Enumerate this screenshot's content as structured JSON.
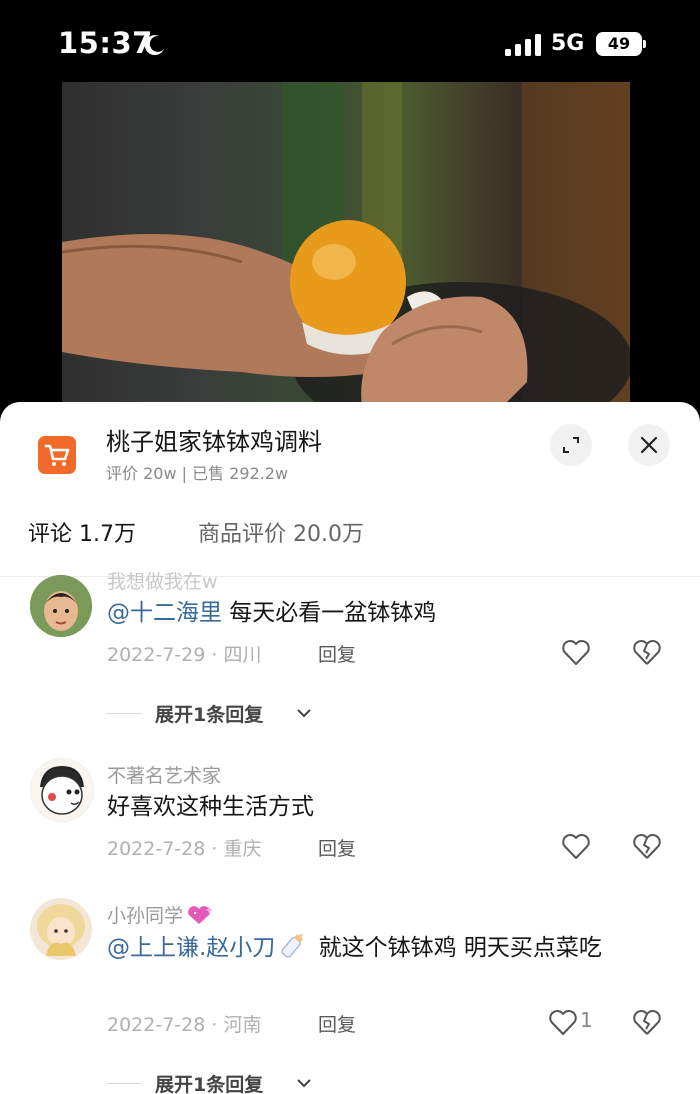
{
  "status_bar": {
    "time": "15:37",
    "network": "5G",
    "battery": "49"
  },
  "product": {
    "title": "桃子姐家钵钵鸡调料",
    "subtitle": "评价 20w | 已售 292.2w",
    "icon": "shopping-cart-icon"
  },
  "tabs": [
    {
      "label": "评论 1.7万",
      "active": true
    },
    {
      "label": "商品评价 20.0万",
      "active": false
    }
  ],
  "comments": [
    {
      "username": "我想做我在w",
      "mention": "@十二海里",
      "text": " 每天必看一盆钵钵鸡",
      "date": "2022-7-29",
      "location": "四川",
      "meta": "2022-7-29 · 四川",
      "reply_label": "回复",
      "likes": "",
      "expand_label": "展开1条回复"
    },
    {
      "username": "不著名艺术家",
      "mention": "",
      "text": "好喜欢这种生活方式",
      "date": "2022-7-28",
      "location": "重庆",
      "meta": "2022-7-28 · 重庆",
      "reply_label": "回复",
      "likes": ""
    },
    {
      "username": "小孙同学",
      "badge_icon": "sparkling-heart-icon",
      "mention": "@上上谦.赵小刀",
      "mention_icon": "baby-bottle-icon",
      "text": " 就这个钵钵鸡 明天买点菜吃",
      "date": "2022-7-28",
      "location": "河南",
      "meta": "2022-7-28 · 河南",
      "reply_label": "回复",
      "likes": "1",
      "expand_label": "展开1条回复"
    }
  ],
  "colors": {
    "accent": "#f26a2a",
    "mention": "#3a6a9a",
    "text": "#161616",
    "muted": "#b0b0b0"
  }
}
